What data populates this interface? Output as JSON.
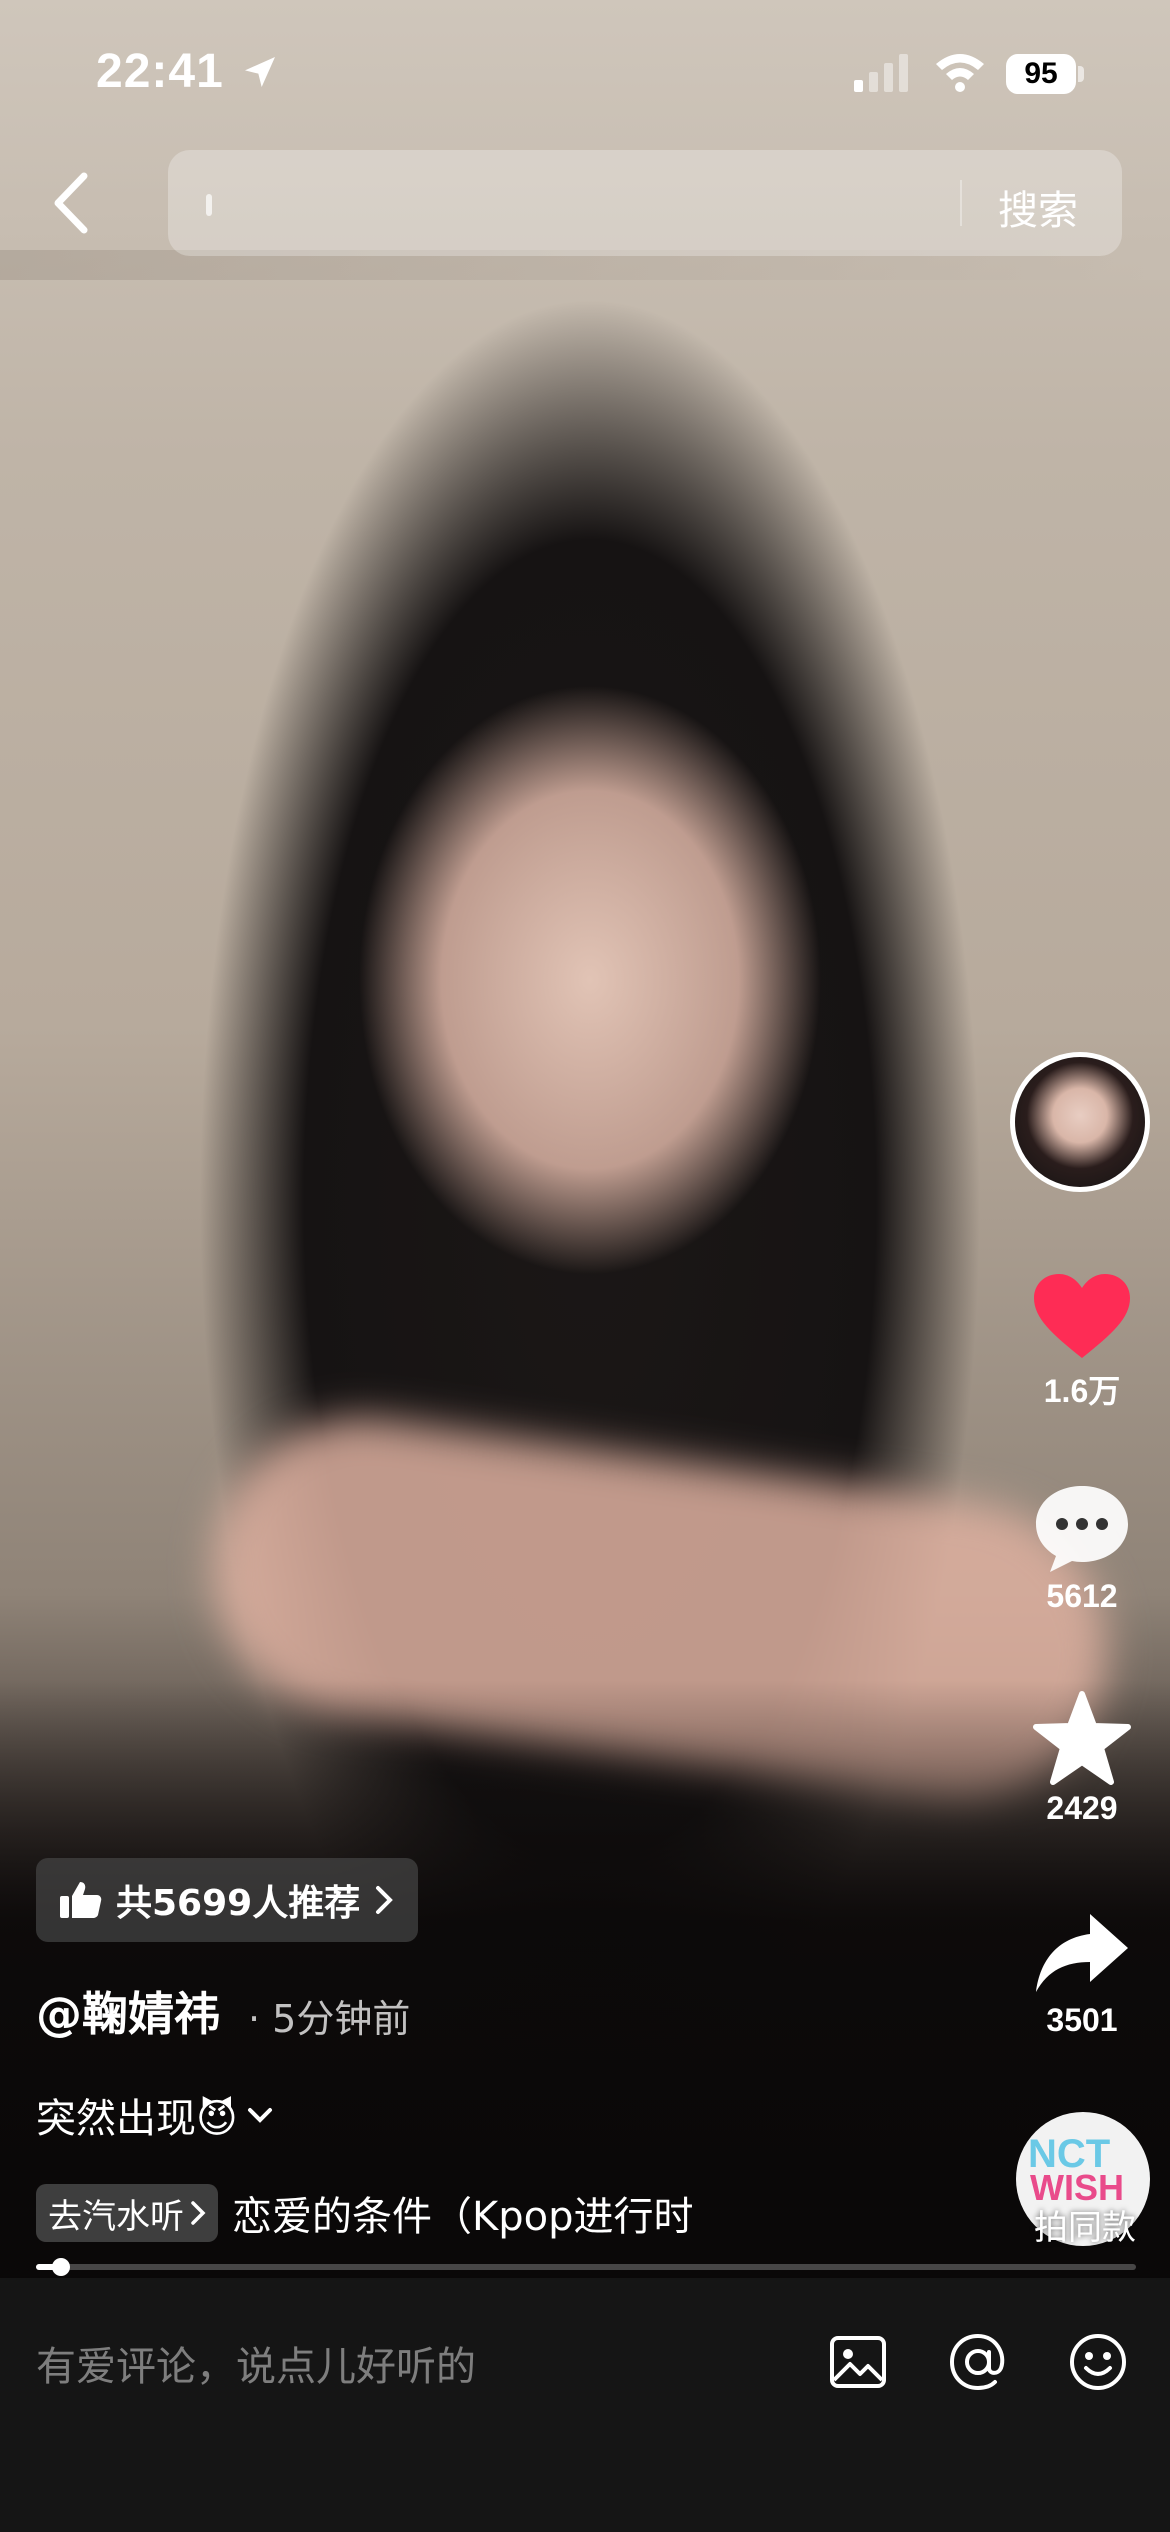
{
  "status_bar": {
    "time": "22:41",
    "battery": "95"
  },
  "search": {
    "placeholder": "",
    "button_label": "搜索"
  },
  "rail": {
    "likes": "1.6万",
    "comments": "5612",
    "favorites": "2429",
    "shares": "3501",
    "music_action": "拍同款",
    "disc_text_top": "NCT",
    "disc_text_bottom": "WISH"
  },
  "video_info": {
    "recommend": "共5699人推荐",
    "author": "@鞠婧祎",
    "time_ago": "· 5分钟前",
    "caption": "突然出现😈",
    "music_tag": "去汽水听",
    "music_title": "恋爱的条件（Kpop进行时",
    "progress": 0.02
  },
  "comment_bar": {
    "placeholder": "有爱评论，说点儿好听的"
  },
  "colors": {
    "like_red": "#fe2c55",
    "comment_bg": "#151515"
  },
  "icons": [
    "location-arrow-icon",
    "signal-icon",
    "wifi-icon",
    "battery-icon",
    "back-chevron-icon",
    "thumbs-up-icon",
    "chevron-right-icon",
    "heart-icon",
    "comment-bubble-icon",
    "star-icon",
    "share-arrow-icon",
    "chevron-down-icon",
    "image-icon",
    "at-icon",
    "emoji-icon"
  ]
}
